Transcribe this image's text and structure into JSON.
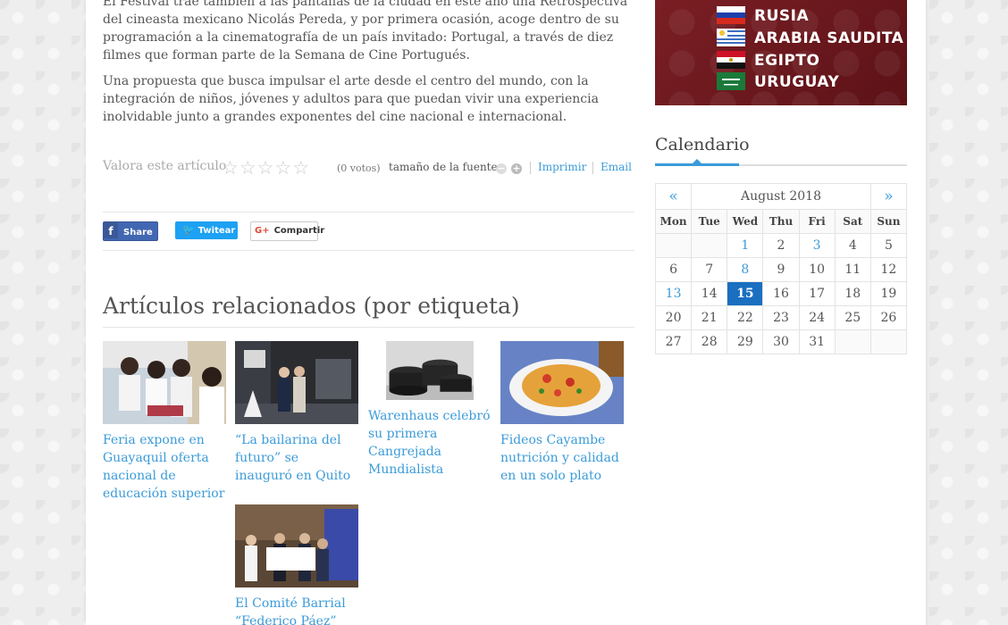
{
  "article": {
    "p1": "El Festival trae también a las pantallas de la ciudad en este año una Retrospectiva del cineasta mexicano Nicolás Pereda, y por primera ocasión, acoge dentro de su programación a la cinematografía de un país invitado: Portugal, a través de diez filmes que forman parte de la Semana de Cine Portugués.",
    "p2": "Una propuesta que busca impulsar el arte desde el centro del mundo, con la integración de niños, jóvenes y adultos para que puedan vivir una experiencia inolvidable junto a grandes exponentes del cine nacional e internacional."
  },
  "rating": {
    "label": "Valora este artículo",
    "star": "☆",
    "votes": "(0 votos)",
    "stars_filled": 0,
    "stars_total": 5
  },
  "font_size": {
    "label": "tamaño de la fuente",
    "decrease": "−",
    "increase": "+"
  },
  "actions": {
    "print": "Imprimir",
    "email": "Email"
  },
  "share": {
    "facebook": "Share",
    "facebook_icon": "f",
    "twitter": "Twitear",
    "twitter_icon": "🐦",
    "google": "Compartir",
    "google_icon": "G+"
  },
  "related": {
    "title": "Artículos relacionados (por etiqueta)",
    "items": [
      {
        "title": "Feria expone en Guayaquil oferta nacional de educación superior"
      },
      {
        "title": "“La bailarina del futuro” se inauguró en Quito"
      },
      {
        "title": "Warenhaus celebró su primera Cangrejada Mundialista"
      },
      {
        "title": "Fideos Cayambe nutrición y calidad en un solo plato"
      },
      {
        "title": "El Comité Barrial “Federico Páez”"
      }
    ]
  },
  "banner": {
    "countries": [
      "RUSIA",
      "ARABIA SAUDITA",
      "EGIPTO",
      "URUGUAY"
    ]
  },
  "calendar": {
    "title": "Calendario",
    "prev": "«",
    "next": "»",
    "month": "August 2018",
    "weekdays": [
      "Mon",
      "Tue",
      "Wed",
      "Thu",
      "Fri",
      "Sat",
      "Sun"
    ],
    "weeks": [
      [
        "",
        "",
        "1",
        "2",
        "3",
        "4",
        "5"
      ],
      [
        "6",
        "7",
        "8",
        "9",
        "10",
        "11",
        "12"
      ],
      [
        "13",
        "14",
        "15",
        "16",
        "17",
        "18",
        "19"
      ],
      [
        "20",
        "21",
        "22",
        "23",
        "24",
        "25",
        "26"
      ],
      [
        "27",
        "28",
        "29",
        "30",
        "31",
        "",
        ""
      ]
    ],
    "linked_days": [
      "1",
      "3",
      "8",
      "13"
    ],
    "today": "15"
  },
  "colors": {
    "link": "#3b9bd8",
    "today_bg": "#1a6fc0",
    "banner_bg": "#6b1a1f",
    "facebook": "#4267b2",
    "twitter": "#1da1f2"
  }
}
